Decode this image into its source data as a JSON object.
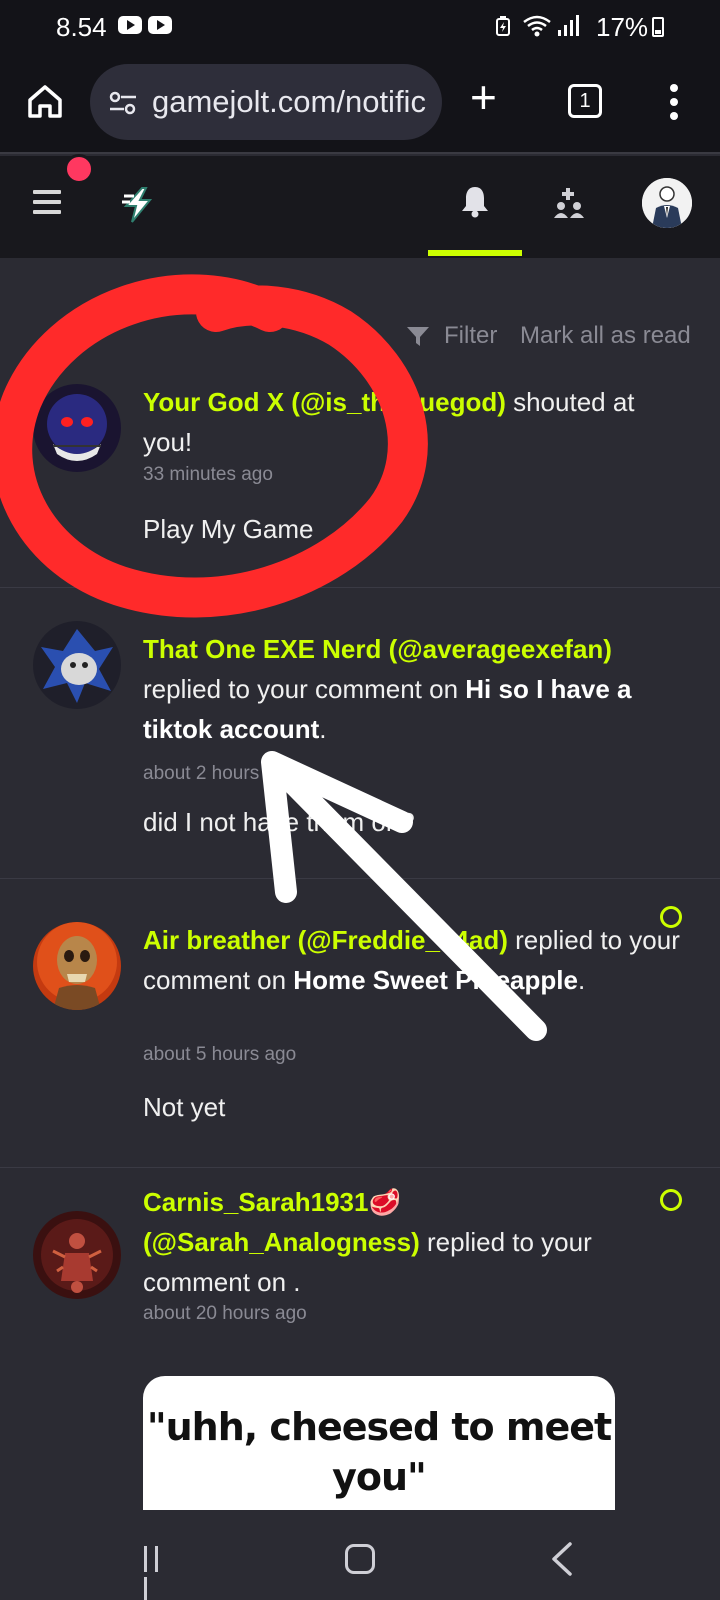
{
  "status_bar": {
    "time": "8.54",
    "battery": "17%"
  },
  "browser": {
    "url": "gamejolt.com/notific",
    "tab_count": "1"
  },
  "filter": {
    "label": "Filter",
    "mark_all": "Mark all as read"
  },
  "notifications": [
    {
      "user": "Your God X (@is_thetruegod)",
      "action": " shouted at you!",
      "time": "33 minutes ago",
      "message": "Play My Game",
      "unread": false
    },
    {
      "user": "That One EXE Nerd (@averageexefan)",
      "action": " replied to your comment on ",
      "target": "Hi so I have a tiktok account",
      "suffix": ".",
      "time": "about 2 hours ago",
      "message": "did I not have them on?",
      "unread": false
    },
    {
      "user": "Air breather (@Freddie_e4ad)",
      "action": " replied to your comment on ",
      "target": "Home Sweet Pineapple",
      "suffix": ".",
      "time": "about 5 hours ago",
      "message": "Not yet",
      "unread": true
    },
    {
      "user": "Carnis_Sarah1931🥩 (@Sarah_Analogness)",
      "action": " replied to your comment on .",
      "time": "about 20 hours ago",
      "message_image_text": "\"uhh, cheesed to meet you\"",
      "unread": true
    }
  ],
  "colors": {
    "accent": "#ccff00",
    "background": "#2b2b33",
    "header": "#18181d",
    "notification_dot": "#ff3860",
    "annotation_red": "#ff2a2a"
  }
}
